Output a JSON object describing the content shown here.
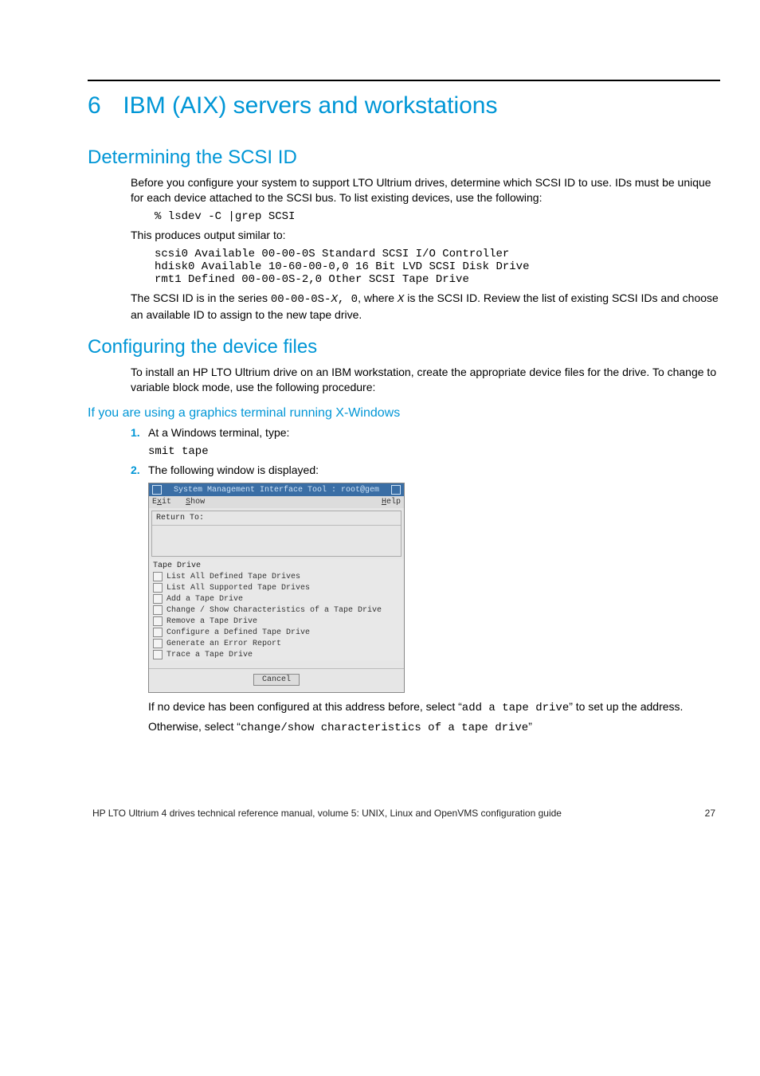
{
  "chapter": {
    "number": "6",
    "title": "IBM (AIX) servers and workstations"
  },
  "s1": {
    "heading": "Determining the SCSI ID",
    "p1": "Before you configure your system to support LTO Ultrium drives, determine which SCSI ID to use. IDs must be unique for each device attached to the SCSI bus. To list existing devices, use the following:",
    "code1": "% lsdev -C |grep SCSI",
    "p2": "This produces output similar to:",
    "code2": "scsi0 Available 00-00-0S Standard SCSI I/O Controller\nhdisk0 Available 10-60-00-0,0 16 Bit LVD SCSI Disk Drive\nrmt1 Defined 00-00-0S-2,0 Other SCSI Tape Drive",
    "p3_a": "The SCSI ID is in the series ",
    "p3_code1": "00-00-0S-",
    "p3_x": "X",
    "p3_code2": ", 0",
    "p3_b": ", where ",
    "p3_x2": "X",
    "p3_c": " is the SCSI ID. Review the list of existing SCSI IDs and choose an available ID to assign to the new tape drive."
  },
  "s2": {
    "heading": "Configuring the device files",
    "p1": "To install an HP LTO Ultrium drive on an IBM workstation, create the appropriate device files for the drive. To change to variable block mode, use the following procedure:"
  },
  "s3": {
    "heading": "If you are using a graphics terminal running X-Windows",
    "step1_num": "1.",
    "step1_text": "At a Windows terminal, type:",
    "step1_code": "smit tape",
    "step2_num": "2.",
    "step2_text": "The following window is displayed:",
    "after_a": "If no device has been configured at this address before, select “",
    "after_code1": "add a tape drive",
    "after_b": "” to set up the address.",
    "after_c": "Otherwise, select “",
    "after_code2": "change/show characteristics of a tape drive",
    "after_d": "”"
  },
  "smit": {
    "title": "System Management Interface Tool : root@gem",
    "menu_exit": "Exit",
    "menu_exit_u": "x",
    "menu_show": "Show",
    "menu_show_u": "S",
    "menu_help": "Help",
    "menu_help_u": "H",
    "return_to": "Return To:",
    "heading": "Tape Drive",
    "items": [
      "List All Defined Tape Drives",
      "List All Supported Tape Drives",
      "Add a Tape Drive",
      "Change / Show Characteristics of a Tape Drive",
      "Remove a Tape Drive",
      "Configure a Defined Tape Drive",
      "Generate an Error Report",
      "Trace a Tape Drive"
    ],
    "cancel": "Cancel"
  },
  "footer": {
    "left": "HP LTO Ultrium 4 drives technical reference manual, volume 5: UNIX, Linux and OpenVMS configuration guide",
    "page": "27"
  }
}
